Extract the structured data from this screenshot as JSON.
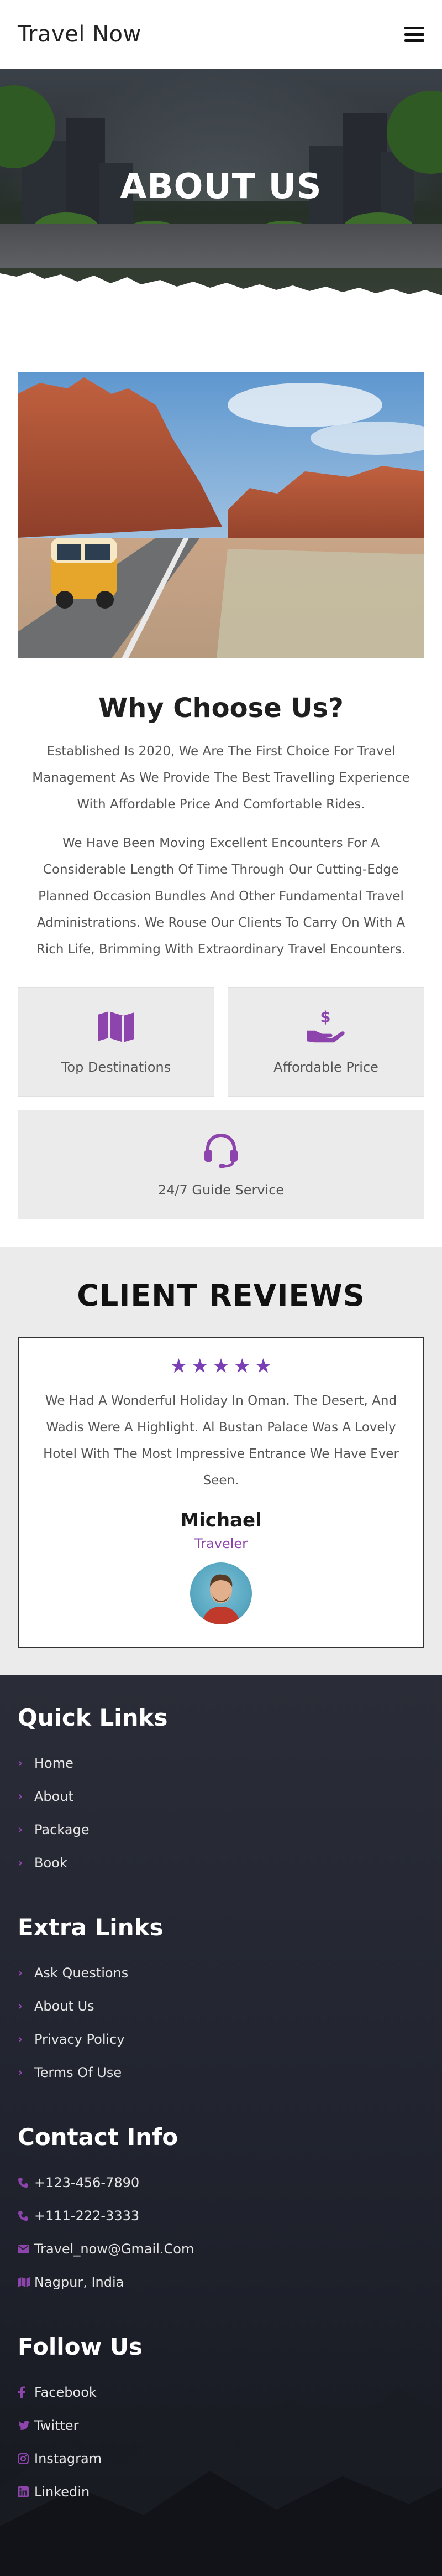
{
  "header": {
    "brand": "Travel Now",
    "menu_icon": "hamburger-menu-icon"
  },
  "hero": {
    "title": "ABOUT US"
  },
  "about": {
    "title": "Why Choose Us?",
    "paragraphs": [
      "Established Is 2020, We Are The First Choice For Travel Management As We Provide The Best Travelling Experience With Affordable Price And Comfortable Rides.",
      "We Have Been Moving Excellent Encounters For A Considerable Length Of Time Through Our Cutting-Edge Planned Occasion Bundles And Other Fundamental Travel Administrations. We Rouse Our Clients To Carry On With A Rich Life, Brimming With Extraordinary Travel Encounters."
    ],
    "features": [
      {
        "label": "Top Destinations",
        "icon": "map-icon"
      },
      {
        "label": "Affordable Price",
        "icon": "hand-dollar-icon"
      },
      {
        "label": "24/7 Guide Service",
        "icon": "headset-icon"
      }
    ]
  },
  "reviews": {
    "title": "CLIENT REVIEWS",
    "rating": 5,
    "text": "We Had A Wonderful Holiday In Oman. The Desert, And Wadis Were A Highlight. Al Bustan Palace Was A Lovely Hotel With The Most Impressive Entrance We Have Ever Seen.",
    "name": "Michael",
    "role": "Traveler"
  },
  "footer": {
    "quick_links": {
      "title": "Quick Links",
      "items": [
        "Home",
        "About",
        "Package",
        "Book"
      ]
    },
    "extra_links": {
      "title": "Extra Links",
      "items": [
        "Ask Questions",
        "About Us",
        "Privacy Policy",
        "Terms Of Use"
      ]
    },
    "contact": {
      "title": "Contact Info",
      "items": [
        {
          "text": "+123-456-7890",
          "icon": "phone-icon"
        },
        {
          "text": "+111-222-3333",
          "icon": "phone-icon"
        },
        {
          "text": "Travel_now@Gmail.Com",
          "icon": "envelope-icon"
        },
        {
          "text": "Nagpur, India",
          "icon": "map-icon"
        }
      ]
    },
    "follow": {
      "title": "Follow Us",
      "items": [
        {
          "text": "Facebook",
          "icon": "facebook-icon"
        },
        {
          "text": "Twitter",
          "icon": "twitter-icon"
        },
        {
          "text": "Instagram",
          "icon": "instagram-icon"
        },
        {
          "text": "Linkedin",
          "icon": "linkedin-icon"
        }
      ]
    }
  },
  "colors": {
    "accent": "#8e44ad",
    "footer_bg": "#23262f",
    "section_bg": "#ebebeb"
  }
}
